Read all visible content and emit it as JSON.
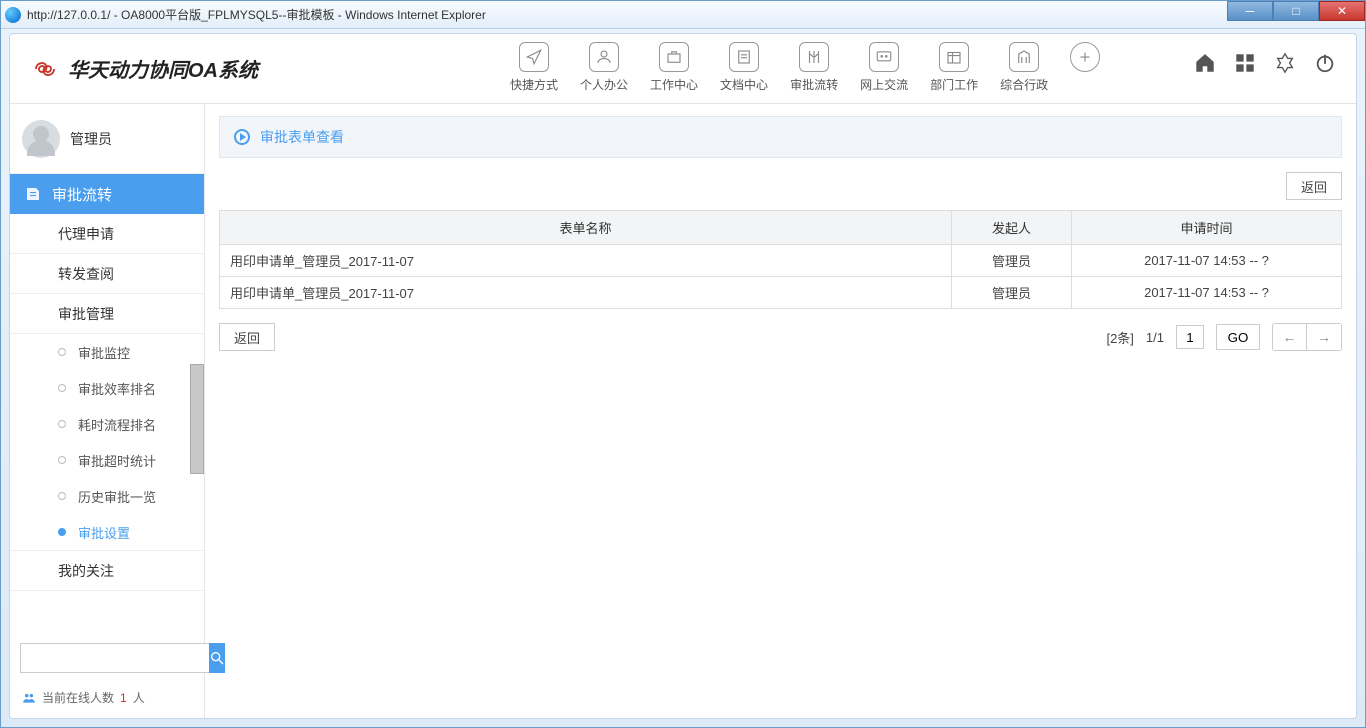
{
  "window": {
    "title": "http://127.0.0.1/ - OA8000平台版_FPLMYSQL5--审批模板 - Windows Internet Explorer"
  },
  "logo": {
    "text": "华天动力协同OA系统"
  },
  "mainNav": [
    {
      "label": "快捷方式",
      "name": "nav-shortcut"
    },
    {
      "label": "个人办公",
      "name": "nav-personal"
    },
    {
      "label": "工作中心",
      "name": "nav-work"
    },
    {
      "label": "文档中心",
      "name": "nav-docs"
    },
    {
      "label": "审批流转",
      "name": "nav-approval"
    },
    {
      "label": "网上交流",
      "name": "nav-chat"
    },
    {
      "label": "部门工作",
      "name": "nav-dept"
    },
    {
      "label": "综合行政",
      "name": "nav-admin"
    }
  ],
  "user": {
    "name": "管理员"
  },
  "sidebar": {
    "sectionTitle": "审批流转",
    "items": [
      {
        "label": "代理申请"
      },
      {
        "label": "转发查阅"
      },
      {
        "label": "审批管理"
      }
    ],
    "subItems": [
      {
        "label": "审批监控",
        "active": false
      },
      {
        "label": "审批效率排名",
        "active": false
      },
      {
        "label": "耗时流程排名",
        "active": false
      },
      {
        "label": "审批超时统计",
        "active": false
      },
      {
        "label": "历史审批一览",
        "active": false
      },
      {
        "label": "审批设置",
        "active": true
      }
    ],
    "footerItem": {
      "label": "我的关注"
    },
    "onlinePrefix": "当前在线人数 ",
    "onlineCount": "1",
    "onlineSuffix": "人"
  },
  "panel": {
    "title": "审批表单查看"
  },
  "buttons": {
    "back": "返回",
    "go": "GO"
  },
  "table": {
    "headers": {
      "name": "表单名称",
      "user": "发起人",
      "time": "申请时间"
    },
    "rows": [
      {
        "name": "用印申请单_管理员_2017-11-07",
        "user": "管理员",
        "time": "2017-11-07 14:53 -- ?"
      },
      {
        "name": "用印申请单_管理员_2017-11-07",
        "user": "管理员",
        "time": "2017-11-07 14:53 -- ?"
      }
    ]
  },
  "pager": {
    "total": "[2条]",
    "pages": "1/1",
    "current": "1"
  }
}
